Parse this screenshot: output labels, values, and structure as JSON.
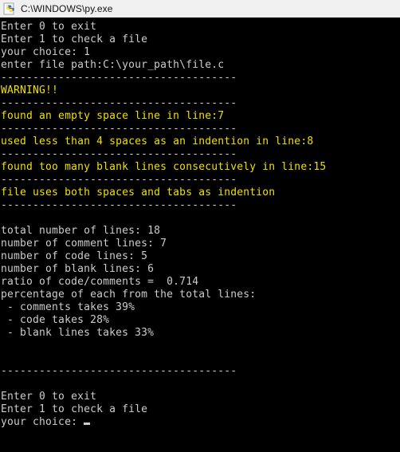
{
  "window": {
    "title": "C:\\WINDOWS\\py.exe",
    "icon": "python-exe-icon",
    "background_color": "#000000",
    "titlebar_color": "#f0f0f0"
  },
  "colors": {
    "console_background": "#000000",
    "text_light": "#cccccc",
    "text_warning": "#ece100"
  },
  "console": {
    "separator": "-------------------------------------",
    "cursor": "block-cursor",
    "lines": [
      {
        "text": "Enter 0 to exit",
        "color": "light"
      },
      {
        "text": "Enter 1 to check a file",
        "color": "light"
      },
      {
        "text": "your choice: 1",
        "color": "light"
      },
      {
        "text": "enter file path:C:\\your_path\\file.c",
        "color": "light"
      },
      {
        "text": "-------------------------------------",
        "color": "light"
      },
      {
        "text": "WARNING!!",
        "color": "yellow"
      },
      {
        "text": "-------------------------------------",
        "color": "light"
      },
      {
        "text": "found an empty space line in line:7",
        "color": "yellow"
      },
      {
        "text": "-------------------------------------",
        "color": "light"
      },
      {
        "text": "used less than 4 spaces as an indention in line:8",
        "color": "yellow"
      },
      {
        "text": "-------------------------------------",
        "color": "light"
      },
      {
        "text": "found too many blank lines consecutively in line:15",
        "color": "yellow"
      },
      {
        "text": "-------------------------------------",
        "color": "light"
      },
      {
        "text": "file uses both spaces and tabs as indention",
        "color": "yellow"
      },
      {
        "text": "-------------------------------------",
        "color": "light"
      },
      {
        "text": "",
        "color": "blank"
      },
      {
        "text": "total number of lines: 18",
        "color": "light"
      },
      {
        "text": "number of comment lines: 7",
        "color": "light"
      },
      {
        "text": "number of code lines: 5",
        "color": "light"
      },
      {
        "text": "number of blank lines: 6",
        "color": "light"
      },
      {
        "text": "ratio of code/comments =  0.714",
        "color": "light"
      },
      {
        "text": "percentage of each from the total lines:",
        "color": "light"
      },
      {
        "text": " - comments takes 39%",
        "color": "light"
      },
      {
        "text": " - code takes 28%",
        "color": "light"
      },
      {
        "text": " - blank lines takes 33%",
        "color": "light"
      },
      {
        "text": "",
        "color": "blank"
      },
      {
        "text": "",
        "color": "blank"
      },
      {
        "text": "-------------------------------------",
        "color": "light"
      },
      {
        "text": "",
        "color": "blank"
      },
      {
        "text": "Enter 0 to exit",
        "color": "light"
      },
      {
        "text": "Enter 1 to check a file",
        "color": "light"
      },
      {
        "text": "your choice: ",
        "color": "light",
        "cursor": true
      }
    ]
  }
}
